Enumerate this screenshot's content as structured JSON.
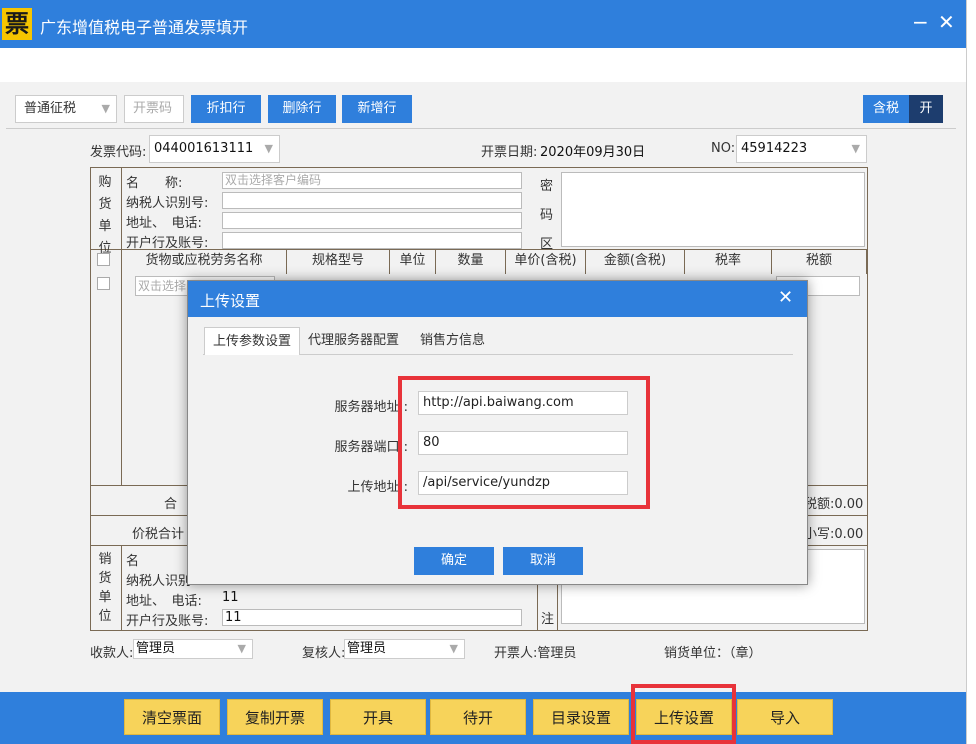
{
  "window": {
    "logo": "票",
    "title": "广东增值税电子普通发票填开",
    "minimize": "−",
    "close": "✕"
  },
  "toolbar": {
    "tax_type": "普通征税",
    "code_placeholder": "开票码",
    "discount": "折扣行",
    "delete_row": "删除行",
    "add_row": "新增行",
    "tax_incl": "含税",
    "toggle": "开"
  },
  "invoice": {
    "code_label": "发票代码:",
    "code": "044001613111",
    "date_label": "开票日期:",
    "date": "2020年09月30日",
    "no_label": "NO:",
    "no": "45914223"
  },
  "buyer": {
    "side": [
      "购",
      "货",
      "单",
      "位"
    ],
    "name_label": "名　　称:",
    "name_placeholder": "双击选择客户编码",
    "taxid_label": "纳税人识别号:",
    "addr_label": "地址、　电话:",
    "bank_label": "开户行及账号:",
    "cipher": [
      "密",
      "码",
      "区"
    ]
  },
  "items": {
    "headers": [
      "货物或应税劳务名称",
      "规格型号",
      "单位",
      "数量",
      "单价(含税)",
      "金额(含税)",
      "税率",
      "税额"
    ],
    "row_placeholder": "双击选择",
    "total_label": "合",
    "tax_total": "税额:0.00",
    "grand_label": "价税合计",
    "small": "小写:0.00"
  },
  "seller": {
    "side": [
      "销",
      "货",
      "单",
      "位"
    ],
    "name_label": "名",
    "taxid_label": "纳税人识别",
    "addr_label": "地址、　电话:",
    "addr": "11",
    "bank_label": "开户行及账号:",
    "bank": "11",
    "remark": "注"
  },
  "footer": {
    "payee_label": "收款人:",
    "payee": "管理员",
    "reviewer_label": "复核人:",
    "reviewer": "管理员",
    "issuer": "开票人:管理员",
    "seal": "销货单位：（章）"
  },
  "bottom_buttons": [
    "清空票面",
    "复制开票",
    "开具",
    "待开",
    "目录设置",
    "上传设置",
    "导入"
  ],
  "dialog": {
    "title": "上传设置",
    "close": "✕",
    "tabs": [
      "上传参数设置",
      "代理服务器配置",
      "销售方信息"
    ],
    "active_tab": 0,
    "fields": [
      {
        "label": "服务器地址",
        "value": "http://api.baiwang.com"
      },
      {
        "label": "服务器端口",
        "value": "80"
      },
      {
        "label": "上传地址",
        "value": "/api/service/yundzp"
      }
    ],
    "ok": "确定",
    "cancel": "取消"
  },
  "colors": {
    "primary": "#2f7fdc",
    "highlight": "#e8333a",
    "button_yellow": "#f7d35a"
  }
}
